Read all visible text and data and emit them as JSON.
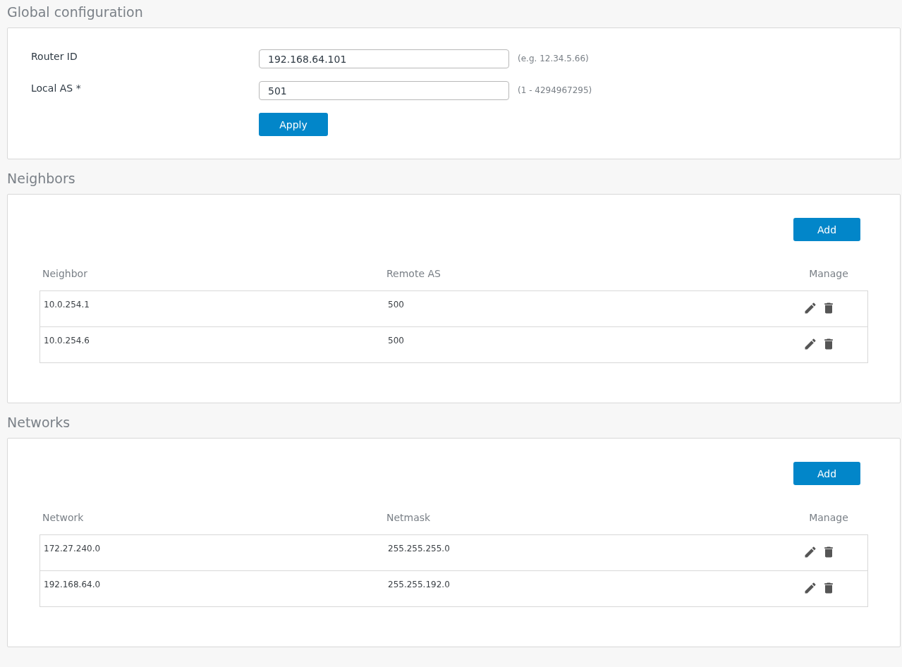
{
  "global_configuration": {
    "title": "Global configuration",
    "fields": [
      {
        "label": "Router ID",
        "value": "192.168.64.101",
        "hint": "(e.g. 12.34.5.66)"
      },
      {
        "label": "Local AS *",
        "value": "501",
        "hint": "(1 - 4294967295)"
      }
    ],
    "apply_button": "Apply"
  },
  "neighbors": {
    "title": "Neighbors",
    "add_button": "Add",
    "columns": [
      "Neighbor",
      "Remote AS",
      "Manage"
    ],
    "rows": [
      [
        "10.0.254.1",
        "500"
      ],
      [
        "10.0.254.6",
        "500"
      ]
    ]
  },
  "networks": {
    "title": "Networks",
    "add_button": "Add",
    "columns": [
      "Network",
      "Netmask",
      "Manage"
    ],
    "rows": [
      [
        "172.27.240.0",
        "255.255.255.0"
      ],
      [
        "192.168.64.0",
        "255.255.192.0"
      ]
    ]
  }
}
